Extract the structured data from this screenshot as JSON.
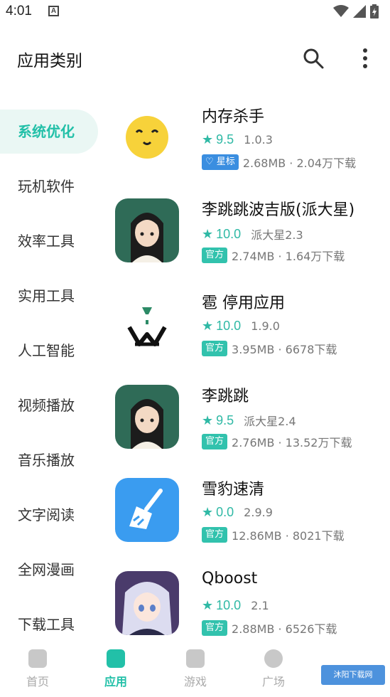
{
  "status_bar": {
    "time": "4:01",
    "a_icon": "A"
  },
  "app_bar": {
    "title": "应用类别"
  },
  "categories": [
    {
      "label": "系统优化",
      "active": true
    },
    {
      "label": "玩机软件"
    },
    {
      "label": "效率工具"
    },
    {
      "label": "实用工具"
    },
    {
      "label": "人工智能"
    },
    {
      "label": "视频播放"
    },
    {
      "label": "音乐播放"
    },
    {
      "label": "文字阅读"
    },
    {
      "label": "全网漫画"
    },
    {
      "label": "下载工具"
    }
  ],
  "apps": [
    {
      "name": "内存杀手",
      "rating": "9.5",
      "version": "1.0.3",
      "badge": "星标",
      "stats": "2.68MB · 2.04万下载",
      "icon": "yellow-face-icon"
    },
    {
      "name": "李跳跳波吉版(派大星)",
      "rating": "10.0",
      "version": "派大星2.3",
      "badge": "官方",
      "stats": "2.74MB · 1.64万下载",
      "icon": "girl-avatar-icon"
    },
    {
      "name": "雹 停用应用",
      "rating": "10.0",
      "version": "1.9.0",
      "badge": "官方",
      "stats": "3.95MB · 6678下载",
      "icon": "hourglass-logo-icon"
    },
    {
      "name": "李跳跳",
      "rating": "9.5",
      "version": "派大星2.4",
      "badge": "官方",
      "stats": "2.76MB · 13.52万下载",
      "icon": "girl-avatar-icon"
    },
    {
      "name": "雪豹速清",
      "rating": "0.0",
      "version": "2.9.9",
      "badge": "官方",
      "stats": "12.86MB · 8021下载",
      "icon": "broom-icon"
    },
    {
      "name": "Qboost",
      "rating": "10.0",
      "version": "2.1",
      "badge": "官方",
      "stats": "2.88MB · 6526下载",
      "icon": "anime-girl-icon"
    }
  ],
  "bottom_nav": [
    {
      "label": "首页"
    },
    {
      "label": "应用",
      "active": true
    },
    {
      "label": "游戏"
    },
    {
      "label": "广场"
    }
  ],
  "watermark": "沐阳下载网",
  "colors": {
    "accent": "#22c0a8",
    "badge_official": "#32c2ad",
    "badge_star": "#3a8ee0"
  }
}
